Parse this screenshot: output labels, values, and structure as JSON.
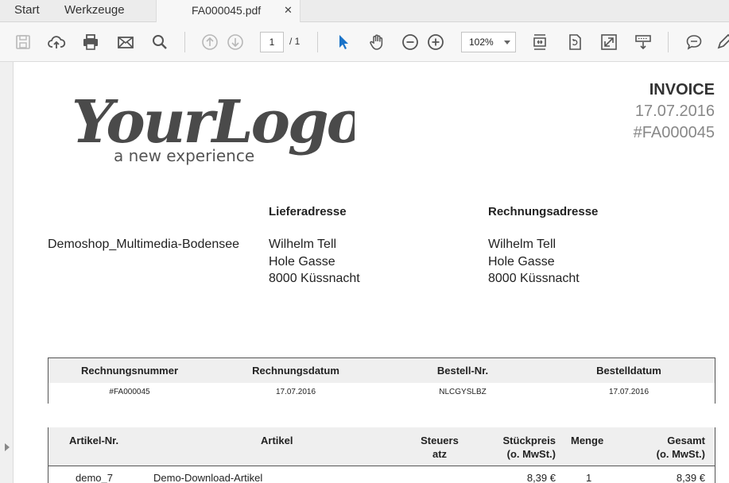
{
  "tabbar": {
    "menu_start": "Start",
    "menu_tools": "Werkzeuge",
    "tab_title": "FA000045.pdf",
    "tab_close": "✕"
  },
  "toolbar": {
    "page_current": "1",
    "page_total": "/ 1",
    "zoom": "102%"
  },
  "logo": {
    "text": "YourLogo",
    "tagline": "a new experience"
  },
  "invoice": {
    "title": "INVOICE",
    "date": "17.07.2016",
    "number": "#FA000045"
  },
  "shop": "Demoshop_Multimedia-Bodensee",
  "delivery": {
    "heading": "Lieferadresse",
    "name": "Wilhelm Tell",
    "street": "Hole Gasse",
    "city": "8000 Küssnacht"
  },
  "billing": {
    "heading": "Rechnungsadresse",
    "name": "Wilhelm Tell",
    "street": "Hole Gasse",
    "city": "8000 Küssnacht"
  },
  "order_table": {
    "headers": [
      "Rechnungsnummer",
      "Rechnungsdatum",
      "Bestell-Nr.",
      "Bestelldatum"
    ],
    "values": [
      "#FA000045",
      "17.07.2016",
      "NLCGYSLBZ",
      "17.07.2016"
    ]
  },
  "items_table": {
    "headers": {
      "article_no": "Artikel-Nr.",
      "article": "Artikel",
      "tax_1": "Steuers",
      "tax_2": "atz",
      "unit_price_1": "Stückpreis",
      "unit_price_2": "(o. MwSt.)",
      "qty": "Menge",
      "total_1": "Gesamt",
      "total_2": "(o. MwSt.)"
    },
    "rows": [
      {
        "article_no": "demo_7",
        "article": "Demo-Download-Artikel",
        "unit_price": "8,39 €",
        "qty": "1",
        "total": "8,39 €"
      }
    ]
  },
  "colors": {
    "tool_icon": "#555555",
    "tool_icon_disabled": "#b8b8b8",
    "select_arrow": "#1a73c8",
    "logo_gray": "#4a4a4a",
    "header_bg": "#efefef"
  }
}
